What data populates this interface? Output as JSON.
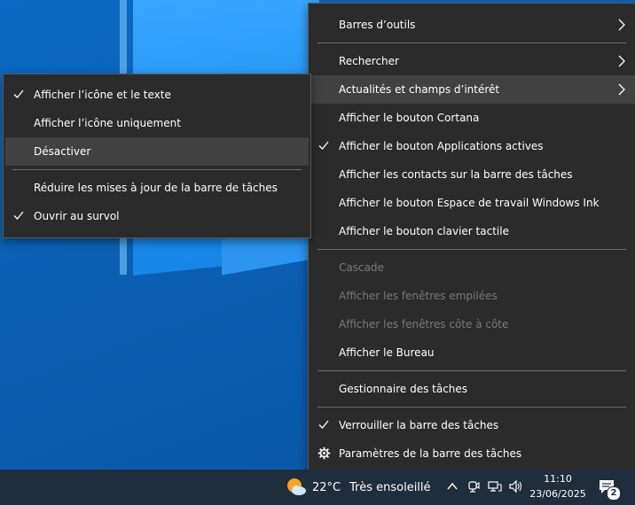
{
  "main_menu": {
    "items": [
      {
        "label": "Barres d’outils",
        "submenu": true
      },
      {
        "label": "Rechercher",
        "submenu": true
      },
      {
        "label": "Actualités et champs d’intérêt",
        "submenu": true,
        "highlighted": true
      },
      {
        "label": "Afficher le bouton Cortana"
      },
      {
        "label": "Afficher le bouton Applications actives",
        "checked": true
      },
      {
        "label": "Afficher les contacts sur la barre des tâches"
      },
      {
        "label": "Afficher le bouton Espace de travail Windows Ink"
      },
      {
        "label": "Afficher le bouton clavier tactile"
      },
      {
        "label": "Cascade",
        "disabled": true
      },
      {
        "label": "Afficher les fenêtres empilées",
        "disabled": true
      },
      {
        "label": "Afficher les fenêtres côte à côte",
        "disabled": true
      },
      {
        "label": "Afficher le Bureau"
      },
      {
        "label": "Gestionnaire des tâches"
      },
      {
        "label": "Verrouiller la barre des tâches",
        "checked": true
      },
      {
        "label": "Paramètres de la barre des tâches",
        "icon": "gear-icon"
      }
    ]
  },
  "sub_menu": {
    "items": [
      {
        "label": "Afficher l’icône et le texte",
        "checked": true
      },
      {
        "label": "Afficher l’icône uniquement"
      },
      {
        "label": "Désactiver",
        "highlighted": true
      },
      {
        "label": "Réduire les mises à jour de la barre de tâches"
      },
      {
        "label": "Ouvrir au survol",
        "checked": true
      }
    ]
  },
  "taskbar": {
    "weather": {
      "temperature": "22°C",
      "condition": "Très ensoleillé",
      "icon": "sun-cloud-icon"
    },
    "clock": {
      "time": "11:10",
      "date": "23/06/2025"
    },
    "notifications": {
      "count": "2"
    },
    "tray_icons": [
      "chevron-up-icon",
      "meet-now-icon",
      "network-icon",
      "volume-icon"
    ]
  },
  "colors": {
    "menu_bg": "#2b2b2b",
    "menu_highlight": "#414141",
    "menu_border": "#5a5a5a",
    "disabled_text": "#7a7a7a",
    "taskbar_bg": "#1f2d3c",
    "desktop_bg": "#0a63b6"
  }
}
